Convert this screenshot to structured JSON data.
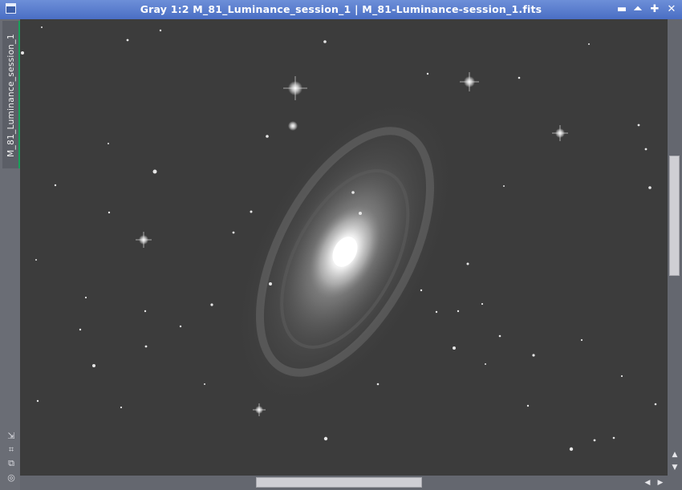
{
  "window": {
    "title": "Gray 1:2 M_81_Luminance_session_1 | M_81-Luminance-session_1.fits",
    "icons": {
      "app": "window-icon",
      "minimize": "minimize-icon",
      "shade": "shade-icon",
      "maximize": "maximize-icon",
      "close": "close-icon"
    },
    "glyphs": {
      "minimize": "▬",
      "shade": "⏶",
      "maximize": "✚",
      "close": "✕"
    }
  },
  "sidebar": {
    "tab_label": "M_81_Luminance_session_1",
    "tab_accent": "#18a15a",
    "tools": [
      {
        "name": "zoom-fit-icon",
        "glyph": "⇲"
      },
      {
        "name": "crosshair-icon",
        "glyph": "⌗"
      },
      {
        "name": "clone-icon",
        "glyph": "⧉"
      },
      {
        "name": "target-icon",
        "glyph": "◎"
      }
    ]
  },
  "image": {
    "subject": "spiral galaxy",
    "background_color": "#3c3c3c"
  },
  "scrollbars": {
    "vertical": {
      "up_glyph": "▲",
      "down_glyph": "▼"
    },
    "horizontal": {
      "left_glyph": "◀",
      "right_glyph": "▶"
    }
  },
  "colors": {
    "titlebar_top": "#6d8fd8",
    "titlebar_bottom": "#4a6ec4",
    "frame": "#6a6d75"
  }
}
